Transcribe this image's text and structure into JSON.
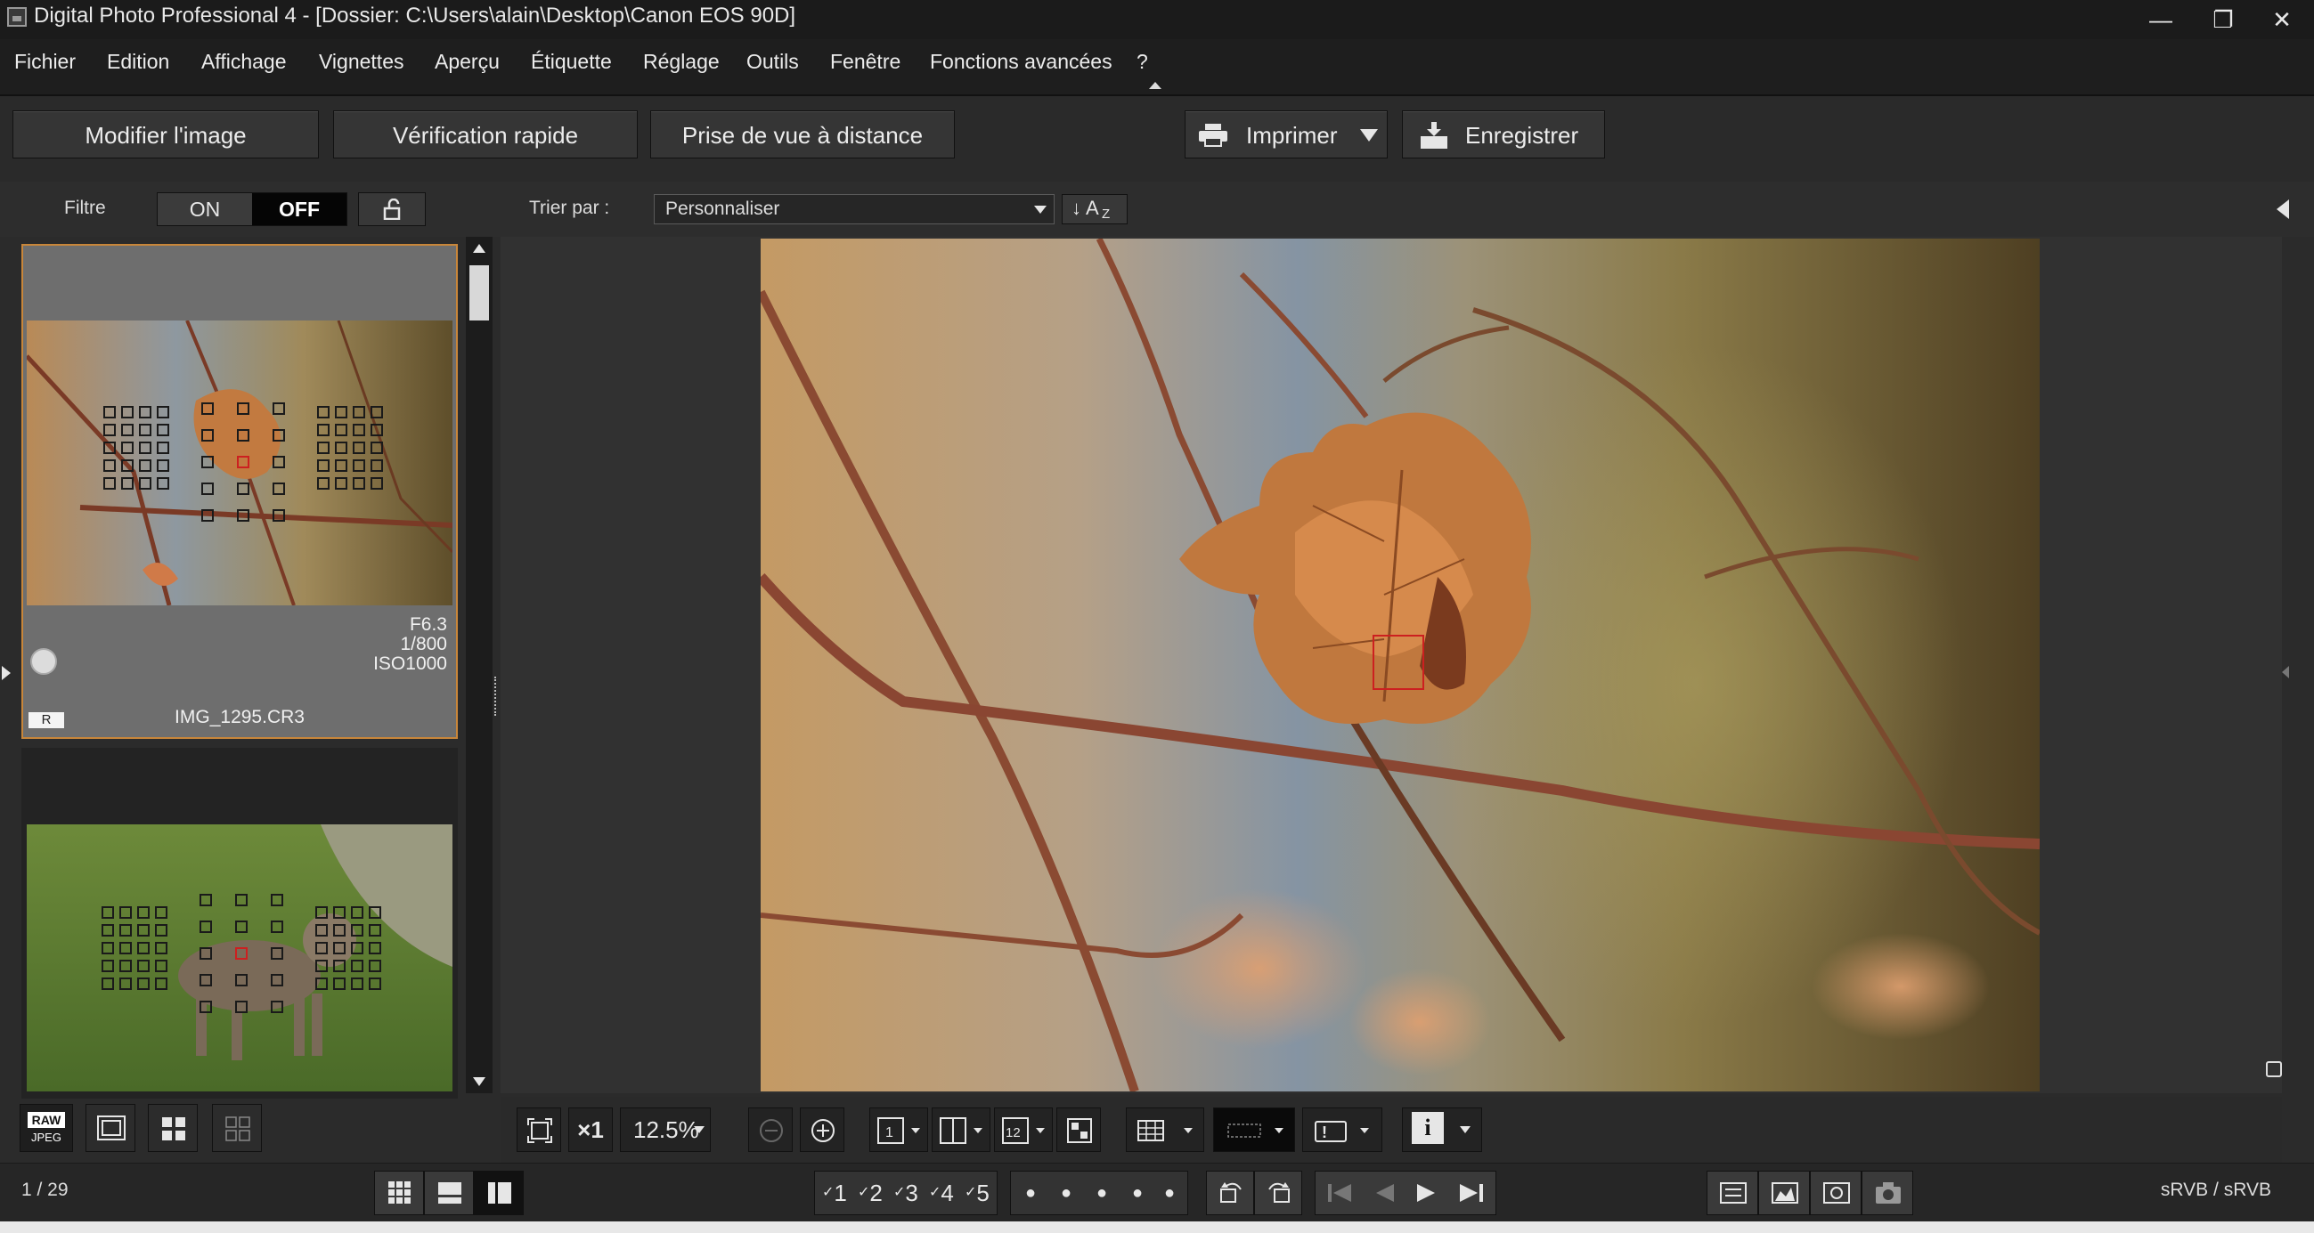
{
  "window": {
    "title": "Digital Photo Professional 4 - [Dossier: C:\\Users\\alain\\Desktop\\Canon EOS 90D]",
    "minimize": "—",
    "restore": "❐",
    "close": "✕"
  },
  "menu": {
    "items": [
      "Fichier",
      "Edition",
      "Affichage",
      "Vignettes",
      "Aperçu",
      "Étiquette",
      "Réglage",
      "Outils",
      "Fenêtre",
      "Fonctions avancées",
      "?"
    ]
  },
  "toolbar": {
    "edit_image": "Modifier l'image",
    "quick_check": "Vérification rapide",
    "remote_shooting": "Prise de vue à distance",
    "print": "Imprimer",
    "save": "Enregistrer"
  },
  "filter": {
    "label": "Filtre",
    "on": "ON",
    "off": "OFF",
    "sort_label": "Trier par :",
    "sort_value": "Personnaliser",
    "sort_order": "A",
    "sort_order_sub": "Z"
  },
  "thumbnails": [
    {
      "aperture": "F6.3",
      "shutter": "1/800",
      "iso": "ISO1000",
      "badge": "R",
      "filename": "IMG_1295.CR3",
      "selected": true
    },
    {
      "selected": false
    }
  ],
  "left_bottom": {
    "raw_label": "RAW",
    "jpeg_label": "JPEG"
  },
  "viewbar": {
    "zoom_x1": "×1",
    "zoom_value": "12.5%",
    "info_icon": "i"
  },
  "status": {
    "count": "1 / 29",
    "ratings": [
      "1",
      "2",
      "3",
      "4",
      "5"
    ],
    "color_space": "sRVB / sRVB"
  },
  "colors": {
    "accent_border": "#c8863a",
    "af_point_active": "#cc2020"
  }
}
